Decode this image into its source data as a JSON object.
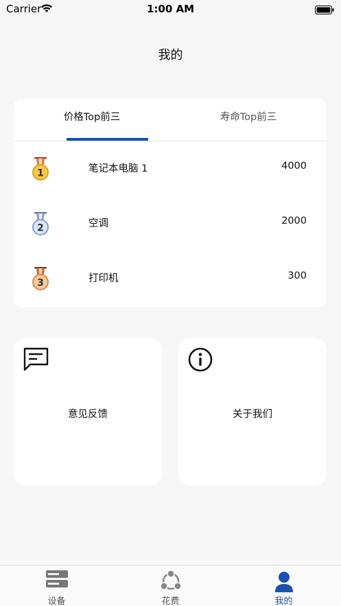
{
  "status_bar": {
    "carrier": "Carrier",
    "time": "1:00 AM"
  },
  "page_title": "我的",
  "ranking": {
    "tabs": [
      {
        "label": "价格Top前三",
        "active": true
      },
      {
        "label": "寿命Top前三",
        "active": false
      }
    ],
    "rows": [
      {
        "rank": "1",
        "medal": "gold-medal-icon",
        "name": "笔记本电脑 1",
        "value": "4000"
      },
      {
        "rank": "2",
        "medal": "silver-medal-icon",
        "name": "空调",
        "value": "2000"
      },
      {
        "rank": "3",
        "medal": "bronze-medal-icon",
        "name": "打印机",
        "value": "300"
      }
    ]
  },
  "actions": [
    {
      "label": "意见反馈",
      "icon": "feedback-message-icon"
    },
    {
      "label": "关于我们",
      "icon": "info-icon"
    }
  ],
  "tab_bar": {
    "items": [
      {
        "label": "设备",
        "icon": "server-icon",
        "active": false
      },
      {
        "label": "花费",
        "icon": "share-cycle-icon",
        "active": false
      },
      {
        "label": "我的",
        "icon": "person-icon",
        "active": true
      }
    ]
  },
  "colors": {
    "accent": "#1a4bb8",
    "tab_active": "#1d4fb1",
    "gold": "#f7c948",
    "silver": "#b8cdea",
    "bronze": "#f3b37a"
  }
}
